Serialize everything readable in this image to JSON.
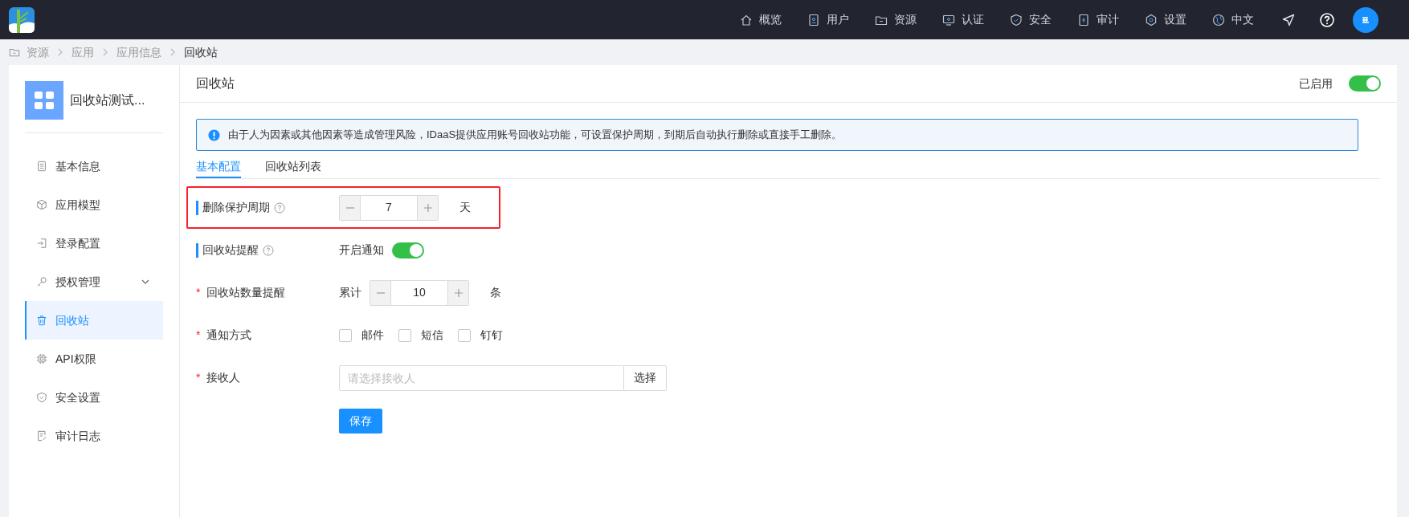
{
  "topbar": {
    "nav": [
      {
        "label": "概览"
      },
      {
        "label": "用户"
      },
      {
        "label": "资源"
      },
      {
        "label": "认证"
      },
      {
        "label": "安全"
      },
      {
        "label": "审计"
      },
      {
        "label": "设置"
      },
      {
        "label": "中文"
      }
    ]
  },
  "breadcrumb": [
    "资源",
    "应用",
    "应用信息",
    "回收站"
  ],
  "sidebar": {
    "app_name": "回收站测试...",
    "items": [
      {
        "label": "基本信息",
        "kind": "item",
        "selected": false
      },
      {
        "label": "应用模型",
        "kind": "item",
        "selected": false
      },
      {
        "label": "登录配置",
        "kind": "item",
        "selected": false
      },
      {
        "label": "授权管理",
        "kind": "submenu",
        "selected": false,
        "expanded": false
      },
      {
        "label": "回收站",
        "kind": "item",
        "selected": true
      },
      {
        "label": "API权限",
        "kind": "item",
        "selected": false
      },
      {
        "label": "安全设置",
        "kind": "item",
        "selected": false
      },
      {
        "label": "审计日志",
        "kind": "item",
        "selected": false
      }
    ]
  },
  "main": {
    "title": "回收站",
    "status_label": "已启用",
    "enabled": true,
    "alert": "由于人为因素或其他因素等造成管理风险，IDaaS提供应用账号回收站功能，可设置保护周期，到期后自动执行删除或直接手工删除。",
    "tabs": [
      {
        "label": "基本配置",
        "selected": true
      },
      {
        "label": "回收站列表",
        "selected": false
      }
    ],
    "form": [
      {
        "kind": "stepper",
        "label": "删除保护周期",
        "section_bar": true,
        "help": true,
        "highlighted": true,
        "value": "7",
        "suffix": "天"
      },
      {
        "kind": "switch",
        "label": "回收站提醒",
        "section_bar": true,
        "help": true,
        "highlighted": false,
        "text": "开启通知",
        "on": true
      },
      {
        "kind": "stepper",
        "label": "回收站数量提醒",
        "section_bar": false,
        "required_mark": "*",
        "help": false,
        "highlighted": false,
        "prefix": "累计",
        "value": "10",
        "suffix": "条"
      },
      {
        "kind": "checkboxes",
        "label": "通知方式",
        "section_bar": false,
        "required_mark": "*",
        "help": false,
        "highlighted": false,
        "options": [
          {
            "label": "邮件",
            "checked": false
          },
          {
            "label": "短信",
            "checked": false
          },
          {
            "label": "钉钉",
            "checked": false
          }
        ]
      },
      {
        "kind": "picker",
        "label": "接收人",
        "section_bar": false,
        "required_mark": "*",
        "help": false,
        "highlighted": false,
        "placeholder": "请选择接收人",
        "button": "选择"
      }
    ],
    "save_button": "保存"
  }
}
